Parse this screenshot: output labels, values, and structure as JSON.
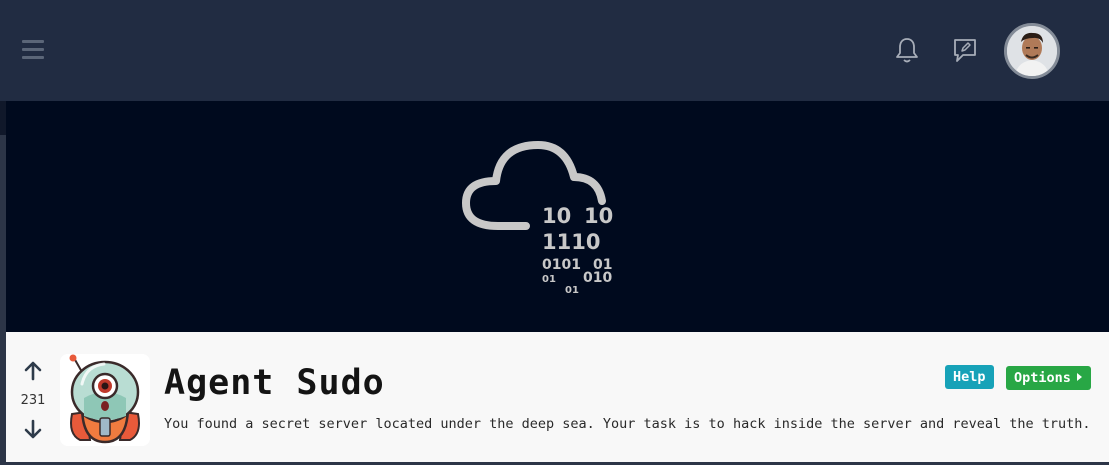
{
  "banner": {
    "binary_rows": [
      "10",
      "10",
      "1110",
      "0101",
      "01",
      "01",
      "010",
      "01"
    ]
  },
  "room": {
    "votes": "231",
    "title": "Agent Sudo",
    "description": "You found a secret server located under the deep sea. Your task is to hack inside the server and reveal the truth.",
    "help_label": "Help",
    "options_label": "Options"
  },
  "colors": {
    "topbar": "#212c42",
    "banner": "#000a1e",
    "help": "#17a2b8",
    "options": "#28a745"
  },
  "icons": [
    "menu-icon",
    "bell-icon",
    "feedback-icon",
    "arrow-up-icon",
    "arrow-down-icon",
    "cloud-binary-icon"
  ]
}
